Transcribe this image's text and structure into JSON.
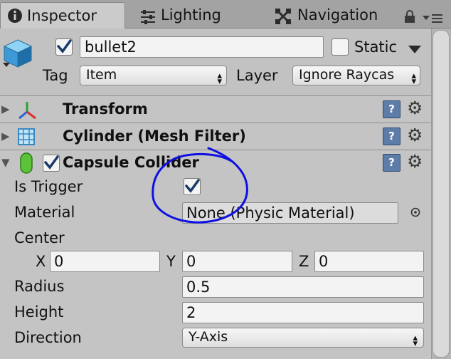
{
  "tabs": {
    "inspector": "Inspector",
    "lighting": "Lighting",
    "navigation": "Navigation"
  },
  "object": {
    "name": "bullet2",
    "static_label": "Static",
    "tag_label": "Tag",
    "tag_value": "Item",
    "layer_label": "Layer",
    "layer_value": "Ignore Raycas"
  },
  "components": {
    "transform": "Transform",
    "mesh_filter": "Cylinder (Mesh Filter)",
    "capsule_collider": "Capsule Collider"
  },
  "collider": {
    "is_trigger_label": "Is Trigger",
    "material_label": "Material",
    "material_value": "None (Physic Material)",
    "center_label": "Center",
    "x_label": "X",
    "x_value": "0",
    "y_label": "Y",
    "y_value": "0",
    "z_label": "Z",
    "z_value": "0",
    "radius_label": "Radius",
    "radius_value": "0.5",
    "height_label": "Height",
    "height_value": "2",
    "direction_label": "Direction",
    "direction_value": "Y-Axis"
  },
  "icons": {
    "inspector": "info-icon",
    "lighting": "lighting-icon",
    "navigation": "navigation-icon",
    "lock": "lock-icon",
    "menu": "tab-menu-icon",
    "gameobject": "cube-icon",
    "transform": "transform-axes-icon",
    "mesh_filter": "mesh-grid-icon",
    "capsule": "capsule-icon",
    "help": "help-book-icon",
    "gear": "gear-icon",
    "object_picker": "object-picker-icon"
  },
  "colors": {
    "annotation": "#1010e0",
    "panel": "#c2c2c2",
    "tabbar": "#a3a3a3"
  }
}
